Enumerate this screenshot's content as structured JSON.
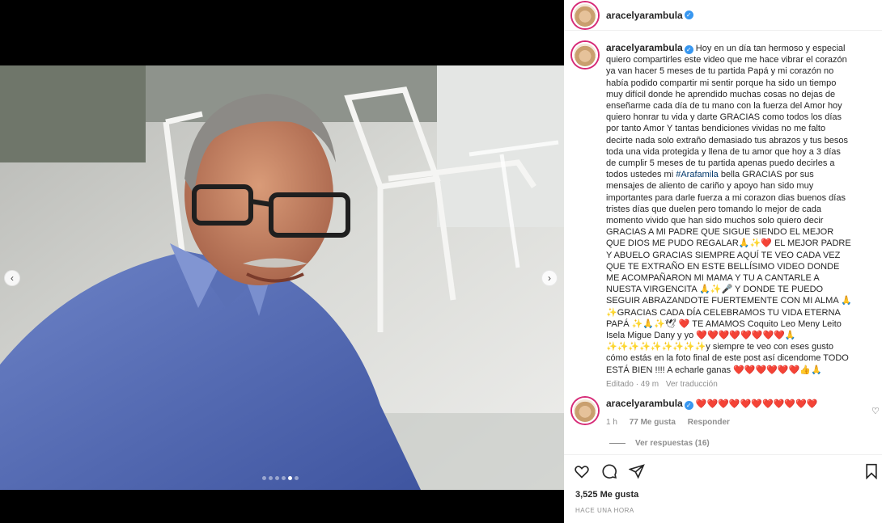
{
  "post": {
    "username": "aracelyarambula",
    "verified_icon": "verified-badge-icon",
    "carousel": {
      "active_index": 4,
      "count": 6,
      "prev_icon": "chevron-left-icon",
      "next_icon": "chevron-right-icon"
    }
  },
  "caption": {
    "username": "aracelyarambula",
    "text_before_hashtag": "Hoy en un día tan hermoso y especial quiero compartirles este video que me hace vibrar el corazón ya van hacer 5 meses de tu partida Papá y mi corazón no había podido compartir mi sentir porque ha sido un tiempo muy difícil donde he aprendido muchas cosas no dejas de enseñarme cada día de tu mano con la fuerza del Amor hoy quiero honrar tu vida y darte GRACIAS como todos los días por tanto Amor Y tantas bendiciones vividas no me falto decirte nada solo extraño demasiado tus abrazos y tus besos toda una vida protegida y llena de tu amor que hoy a 3 días de cumplir 5 meses de tu partida apenas puedo decirles a todos ustedes mi ",
    "hashtag": "#Arafamila",
    "text_after_hashtag": " bella GRACIAS por sus mensajes de aliento de cariño y apoyo han sido muy importantes para darle fuerza a mi corazon dias buenos días tristes días que duelen pero tomando lo mejor de cada momento vivido que han sido muchos solo quiero decir GRACIAS A MI PADRE QUE SIGUE SIENDO EL MEJOR QUE DIOS ME PUDO REGALAR🙏✨❤️ EL MEJOR PADRE Y ABUELO GRACIAS SIEMPRE AQUÍ TE VEO CADA VEZ QUE TE EXTRAÑO EN ESTE BELLÍSIMO VIDEO DONDE ME ACOMPAÑARON MI MAMA Y TU A CANTARLE A NUESTA VIRGENCITA 🙏✨🎤 Y DONDE TE PUEDO SEGUIR ABRAZANDOTE FUERTEMENTE CON MI ALMA 🙏✨GRACIAS CADA DÍA CELEBRAMOS TU VIDA ETERNA PAPÁ ✨🙏✨🕊 ❤️ TE AMAMOS Coquito Leo Meny Leito Isela Migue Dany y yo ❤️❤️❤️❤️❤️❤️❤️❤️🙏✨✨✨✨✨✨✨✨✨y siempre te veo con eses gusto cómo estás en la foto final de este post así dicendome TODO ESTÁ BIEN !!!! A echarle ganas ❤️❤️❤️❤️❤️❤️👍🙏",
    "edited": "Editado · 49 m",
    "see_translation": "Ver traducción"
  },
  "comment": {
    "username": "aracelyarambula",
    "text": "❤️❤️❤️❤️❤️❤️❤️❤️❤️❤️❤️",
    "time": "1 h",
    "likes": "77 Me gusta",
    "reply": "Responder",
    "view_replies": "Ver respuestas (16)"
  },
  "actions": {
    "like_icon": "heart-icon",
    "comment_icon": "comment-icon",
    "share_icon": "share-icon",
    "save_icon": "bookmark-icon"
  },
  "likes_count": "3,525 Me gusta",
  "time_ago": "HACE UNA HORA"
}
